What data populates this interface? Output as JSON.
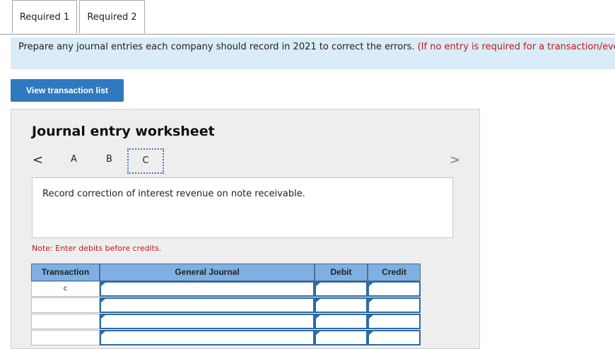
{
  "tabs": [
    {
      "label": "Required 1"
    },
    {
      "label": "Required 2"
    }
  ],
  "instructions": {
    "text": "Prepare any journal entries each company should record in 2021 to correct the errors.",
    "hint": "(If no entry is required for a transaction/event, select \"No journal entry required\" in the first account field.)"
  },
  "view_button": "View transaction list",
  "worksheet": {
    "title": "Journal entry worksheet",
    "nav": {
      "prev": "<",
      "next": ">",
      "letters": [
        "A",
        "B",
        "C"
      ],
      "selected": "C"
    },
    "description": "Record correction of interest revenue on note receivable.",
    "note": "Note: Enter debits before credits.",
    "columns": [
      "Transaction",
      "General Journal",
      "Debit",
      "Credit"
    ],
    "rows": [
      {
        "transaction": "c"
      },
      {
        "transaction": ""
      },
      {
        "transaction": ""
      },
      {
        "transaction": ""
      }
    ]
  },
  "colors": {
    "accent": "#2f79bf",
    "header": "#7eb0e4",
    "note_red": "#c11a1a",
    "instruction_bg": "#d9ecf8"
  }
}
